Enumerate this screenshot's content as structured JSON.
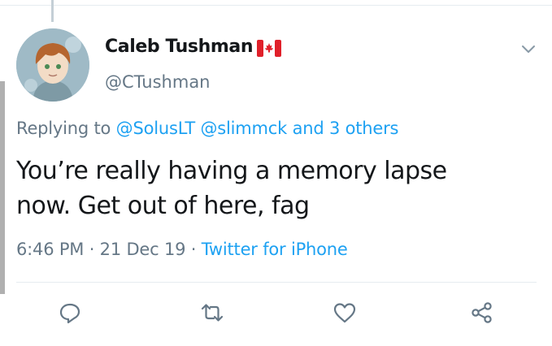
{
  "user": {
    "display_name": "Caleb Tushman",
    "handle": "@CTushman",
    "flag_icon": "canada-flag-icon"
  },
  "reply": {
    "prefix": "Replying to ",
    "mentions": [
      "@SolusLT",
      "@slimmck"
    ],
    "others": "and 3 others"
  },
  "tweet": {
    "lines": [
      "You’re really having a memory lapse",
      "now. Get out of here, fag"
    ]
  },
  "meta": {
    "time": "6:46 PM",
    "separator": " · ",
    "date": "21 Dec 19",
    "source": "Twitter for iPhone"
  },
  "actions": {
    "icons": [
      "reply-icon",
      "retweet-icon",
      "like-icon",
      "share-icon"
    ]
  },
  "colors": {
    "link": "#1da1f2",
    "secondary": "#657786",
    "text": "#14171a",
    "icon": "#657786"
  }
}
